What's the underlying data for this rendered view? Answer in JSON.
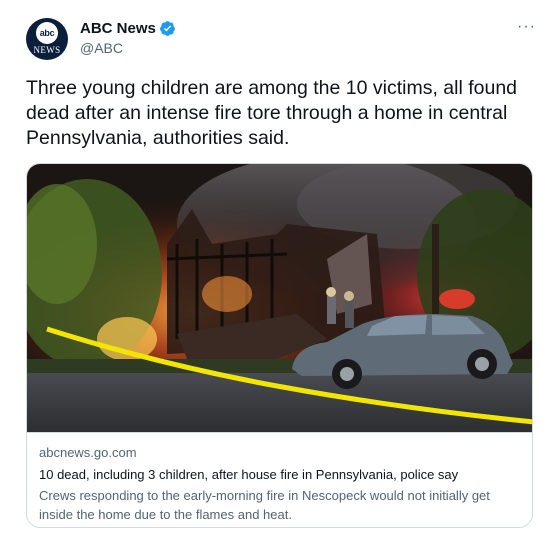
{
  "tweet": {
    "author": {
      "display_name": "ABC News",
      "handle": "@ABC",
      "avatar_logo_text": "abc",
      "avatar_word": "NEWS",
      "verified": true
    },
    "more_icon": "more-horizontal-icon",
    "text": "Three young children are among the 10 victims, all found dead after an intense fire tore through a home in central Pennsylvania, authorities said."
  },
  "card": {
    "domain": "abcnews.go.com",
    "title": "10 dead, including 3 children, after house fire in Pennsylvania, police say",
    "description": "Crews responding to the early-morning fire in Nescopeck would not initially get inside the home due to the flames and heat."
  },
  "colors": {
    "verified_badge": "#1d9bf0",
    "secondary_text": "#536471",
    "caution_tape": "#f2e600"
  }
}
